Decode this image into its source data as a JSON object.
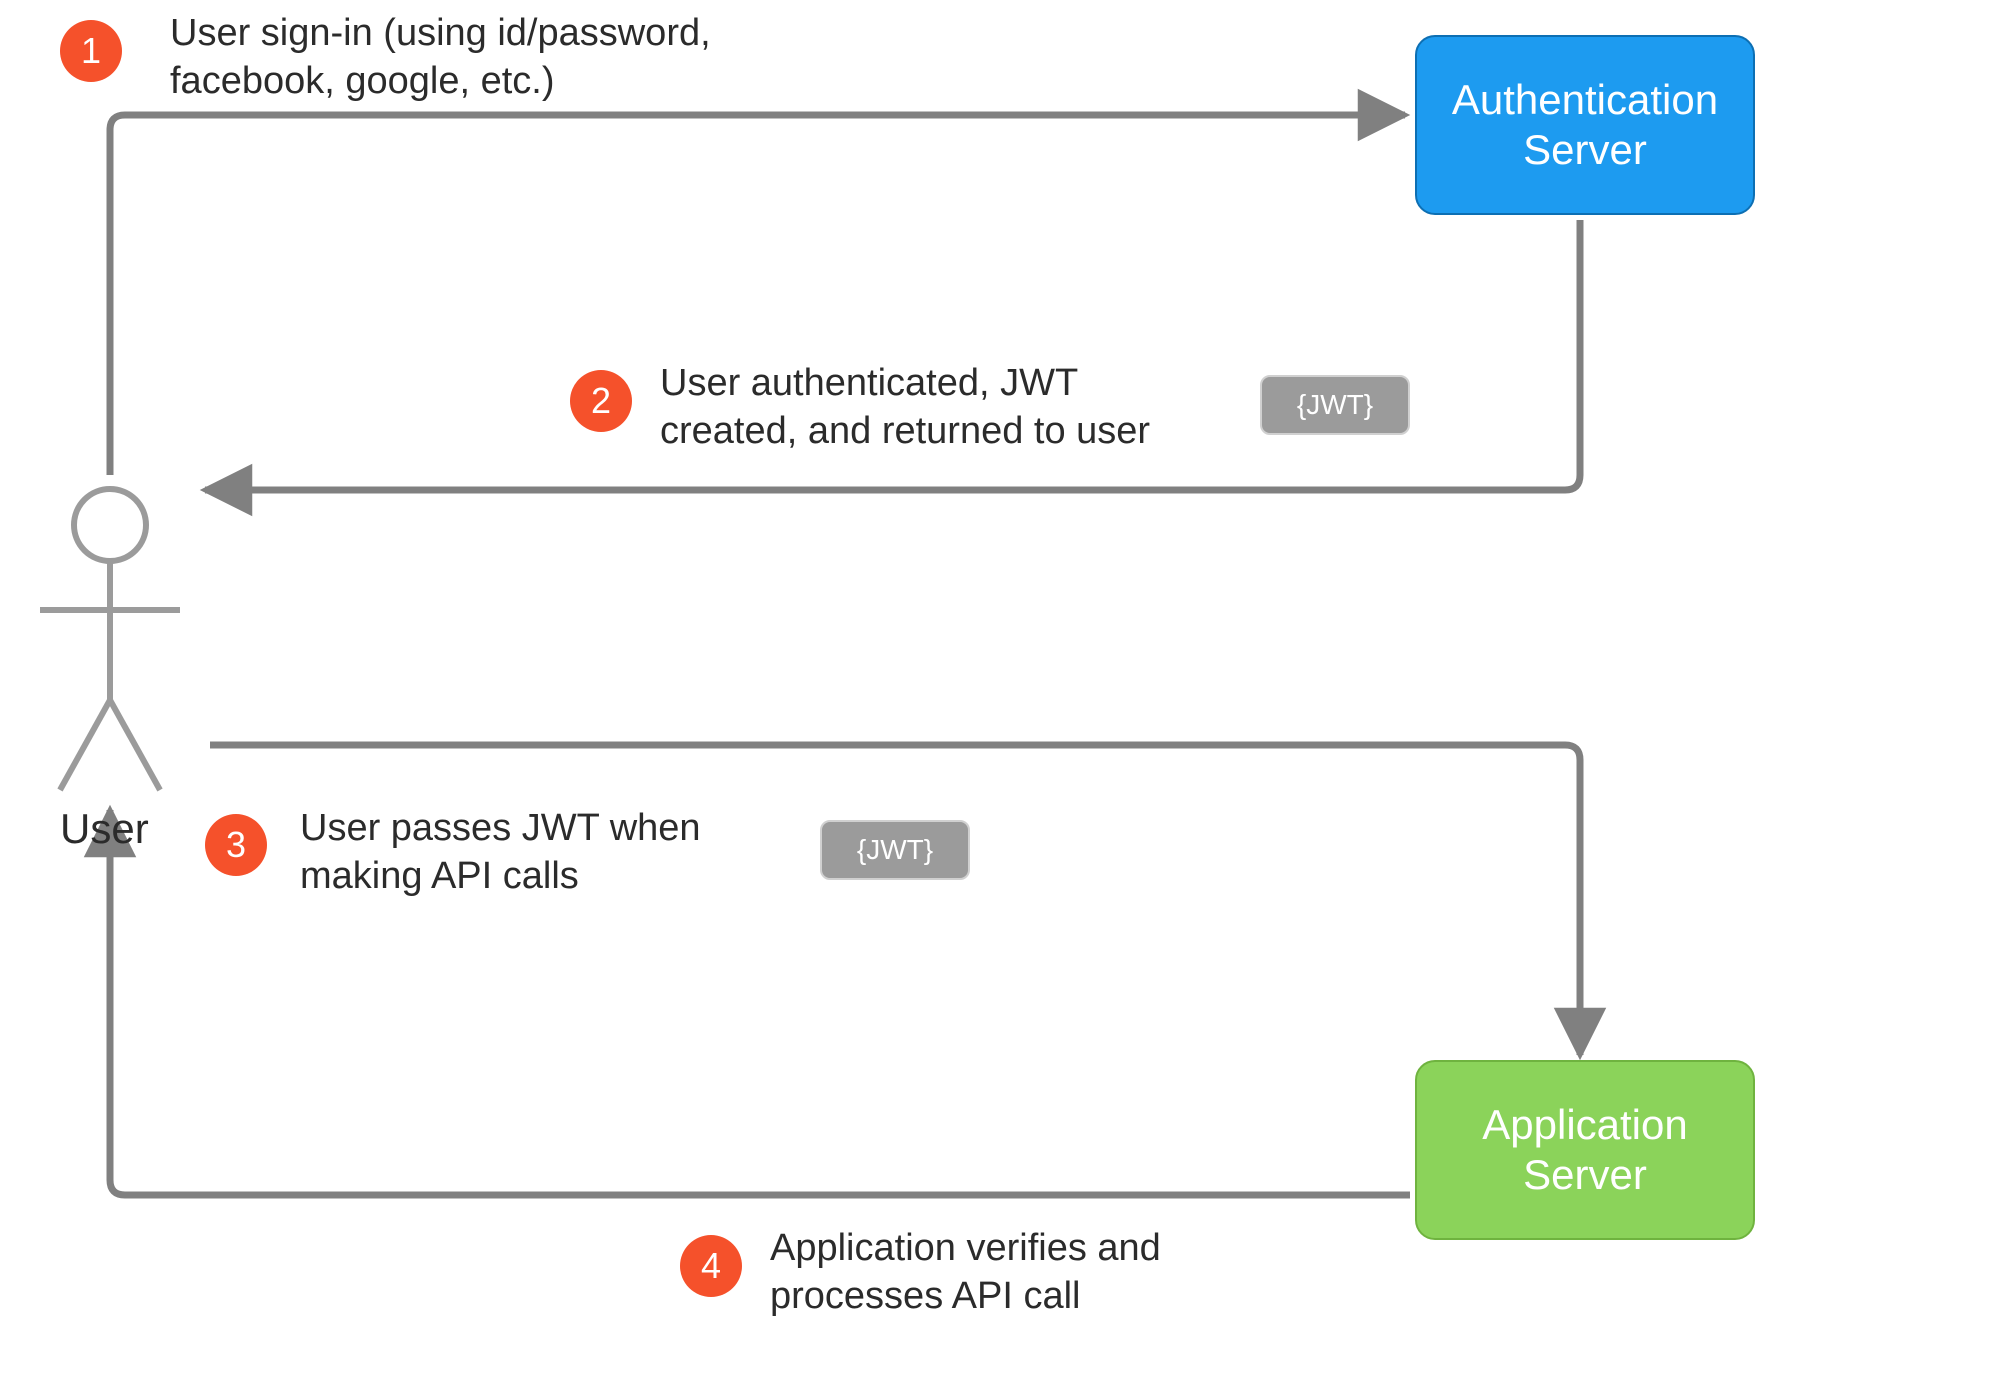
{
  "actors": {
    "user": {
      "label": "User"
    },
    "auth_server": {
      "label": "Authentication\nServer",
      "color": "#1d9bf0"
    },
    "app_server": {
      "label": "Application\nServer",
      "color": "#8bd35a"
    }
  },
  "tokens": {
    "jwt_1": {
      "label": "{JWT}"
    },
    "jwt_2": {
      "label": "{JWT}"
    }
  },
  "steps": [
    {
      "num": "1",
      "text": "User sign-in (using id/password,\nfacebook, google, etc.)"
    },
    {
      "num": "2",
      "text": "User authenticated, JWT\ncreated, and returned to user"
    },
    {
      "num": "3",
      "text": "User passes JWT when\nmaking API calls"
    },
    {
      "num": "4",
      "text": "Application verifies and\nprocesses API call"
    }
  ],
  "colors": {
    "badge": "#f5512b",
    "arrow": "#808080",
    "jwt_chip": "#9b9b9b"
  }
}
